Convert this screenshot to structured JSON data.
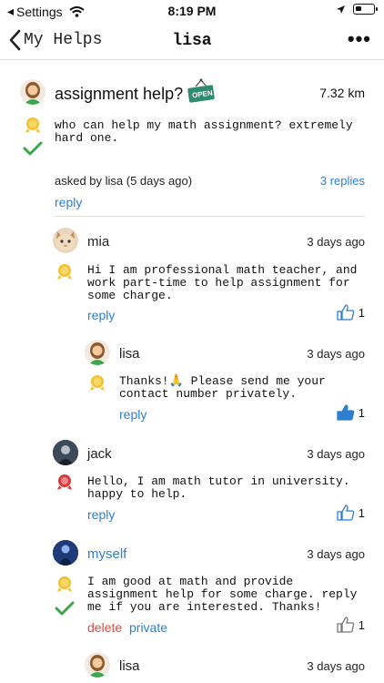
{
  "status": {
    "back_app": "Settings",
    "time": "8:19 PM"
  },
  "nav": {
    "back_label": "My Helps",
    "title": "lisa",
    "more": "•••"
  },
  "post": {
    "title": "assignment help?",
    "open_badge": "OPEN",
    "distance": "7.32 km",
    "body": "who can help my math assignment? extremely\nhard one.",
    "asked_by": "asked by lisa (5 days ago)",
    "replies_count": "3 replies",
    "reply_label": "reply"
  },
  "replies": [
    {
      "user": "mia",
      "time": "3 days ago",
      "body": "Hi I am professional math teacher, and\nwork part-time to help assignment for\nsome charge.",
      "reply_label": "reply",
      "likes": "1"
    },
    {
      "user": "lisa",
      "time": "3 days ago",
      "body_pre": "Thanks!",
      "body_post": " Please send me your\ncontact number privately.",
      "emoji": "🙏",
      "reply_label": "reply",
      "likes": "1"
    },
    {
      "user": "jack",
      "time": "3 days ago",
      "body": "Hello, I am math tutor in university.\nhappy to help.",
      "reply_label": "reply",
      "likes": "1"
    },
    {
      "user": "myself",
      "time": "3 days ago",
      "body": "I am good at math and provide\nassignment help for some charge. reply\nme if you are interested. Thanks!",
      "delete_label": "delete",
      "private_label": "private",
      "likes": "1"
    },
    {
      "user": "lisa",
      "time": "3 days ago"
    }
  ],
  "colors": {
    "link": "#2f7fcf",
    "delete": "#e04a3f",
    "check": "#3aa84a",
    "badge_gold": "#f2c230",
    "badge_red": "#d63a3a",
    "open_badge": "#2e8b6e"
  }
}
